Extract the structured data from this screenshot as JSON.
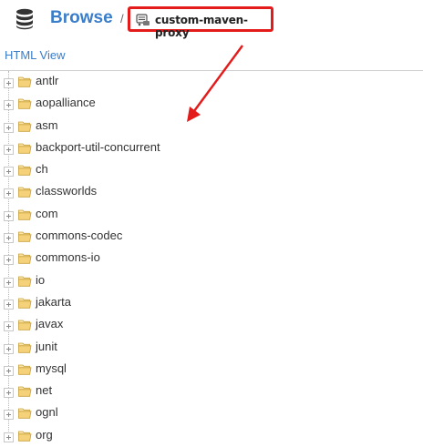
{
  "header": {
    "title": "Browse",
    "separator": "/",
    "repository": "custom-maven-proxy",
    "db_icon": "database-icon",
    "repo_icon": "repository-icon"
  },
  "view_link": "HTML View",
  "tree": {
    "expander_icon": "expand-plus-icon",
    "folder_icon": "folder-open-icon",
    "items": [
      {
        "label": "antlr"
      },
      {
        "label": "aopalliance"
      },
      {
        "label": "asm"
      },
      {
        "label": "backport-util-concurrent"
      },
      {
        "label": "ch"
      },
      {
        "label": "classworlds"
      },
      {
        "label": "com"
      },
      {
        "label": "commons-codec"
      },
      {
        "label": "commons-io"
      },
      {
        "label": "io"
      },
      {
        "label": "jakarta"
      },
      {
        "label": "javax"
      },
      {
        "label": "junit"
      },
      {
        "label": "mysql"
      },
      {
        "label": "net"
      },
      {
        "label": "ognl"
      },
      {
        "label": "org"
      }
    ]
  },
  "colors": {
    "brand_blue": "#3a7dc9",
    "annotation_red": "#e31b1b",
    "folder_fill": "#f5d27a",
    "folder_stroke": "#c9a13b"
  }
}
